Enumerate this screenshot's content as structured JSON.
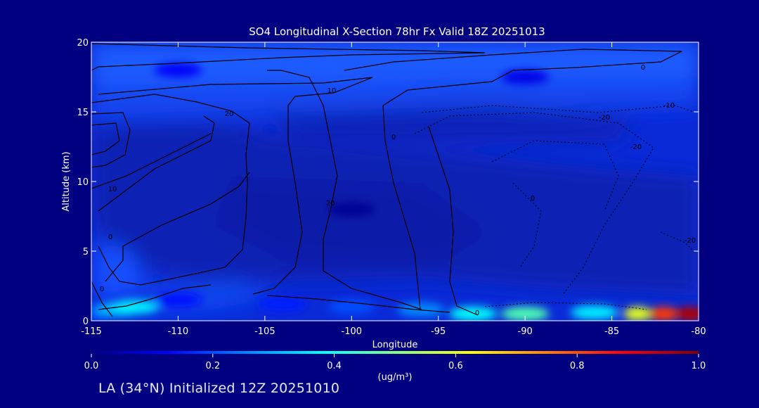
{
  "chart_data": {
    "type": "heatmap",
    "title": "SO4 Longitudinal X-Section 78hr  Fx Valid 18Z 20251013",
    "xlabel": "Longitude",
    "ylabel": "Altitude (km)",
    "xlim": [
      -115,
      -80
    ],
    "ylim": [
      0,
      20
    ],
    "x_ticks": [
      "-115",
      "-110",
      "-105",
      "-100",
      "-95",
      "-90",
      "-85",
      "-80"
    ],
    "y_ticks": [
      "0",
      "5",
      "10",
      "15",
      "20"
    ],
    "colorbar": {
      "range": [
        0.0,
        1.0
      ],
      "ticks": [
        "0.0",
        "0.2",
        "0.4",
        "0.6",
        "0.8",
        "1.0"
      ],
      "unit": "(ug/m³)",
      "colormap": [
        "#000080",
        "#0000ff",
        "#0080ff",
        "#00ffff",
        "#80ff80",
        "#ffff00",
        "#ff8000",
        "#ff0000",
        "#800000"
      ]
    },
    "field": [
      {
        "lon": -115.0,
        "alt": 0.5,
        "value": 0.18
      },
      {
        "lon": -113.5,
        "alt": 0.8,
        "value": 0.3
      },
      {
        "lon": -112.5,
        "alt": 1.0,
        "value": 0.36
      },
      {
        "lon": -110.0,
        "alt": 1.5,
        "value": 0.14
      },
      {
        "lon": -104.0,
        "alt": 1.2,
        "value": 0.15
      },
      {
        "lon": -100.0,
        "alt": 1.0,
        "value": 0.2
      },
      {
        "lon": -96.0,
        "alt": 0.8,
        "value": 0.26
      },
      {
        "lon": -93.0,
        "alt": 0.5,
        "value": 0.38
      },
      {
        "lon": -90.0,
        "alt": 0.5,
        "value": 0.45
      },
      {
        "lon": -86.0,
        "alt": 0.6,
        "value": 0.36
      },
      {
        "lon": -83.5,
        "alt": 0.5,
        "value": 0.6
      },
      {
        "lon": -82.0,
        "alt": 0.5,
        "value": 0.82
      },
      {
        "lon": -80.5,
        "alt": 0.5,
        "value": 0.95
      },
      {
        "lon": -100.0,
        "alt": 8.0,
        "value": 0.02
      },
      {
        "lon": -110.0,
        "alt": 18.0,
        "value": 0.12
      },
      {
        "lon": -90.0,
        "alt": 17.5,
        "value": 0.1
      }
    ],
    "contour_labels": [
      "0",
      "10",
      "20",
      "0",
      "10",
      "20",
      "0",
      "0",
      "0",
      "0",
      "-10",
      "-20",
      "-20",
      "-20"
    ],
    "grid": false,
    "legend": "none"
  },
  "footer": {
    "caption": "LA (34°N) Initialized 12Z 20251010"
  }
}
